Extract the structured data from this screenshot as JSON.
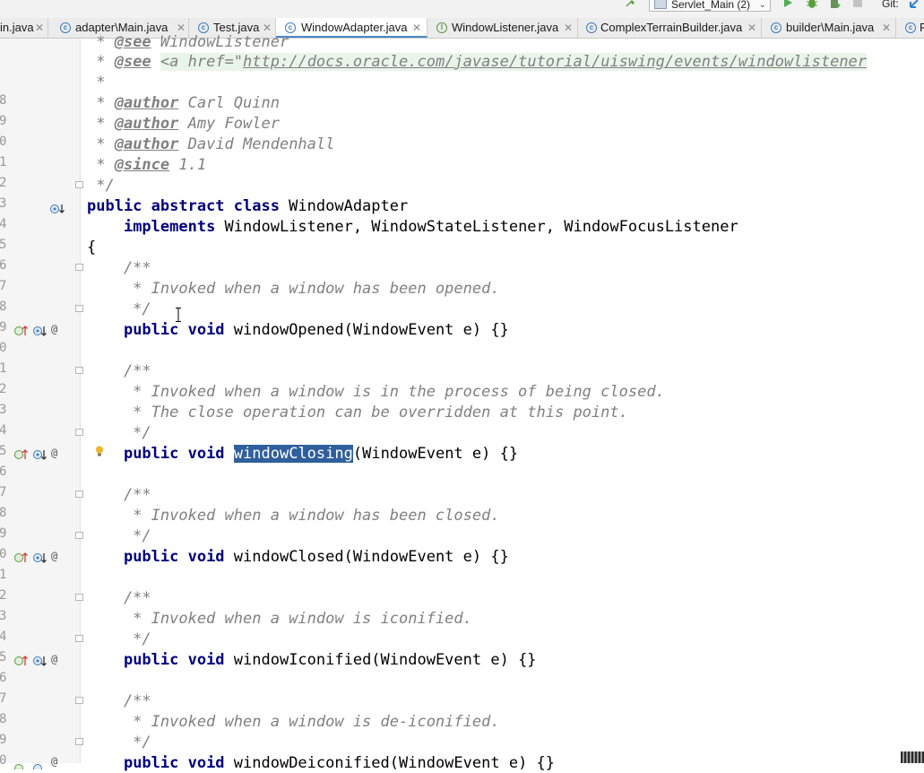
{
  "toolbar": {
    "run_config": "Servlet_Main (2)",
    "git_label": "Git:",
    "icons": [
      "hammer-icon",
      "run-icon",
      "debug-icon",
      "coverage-icon",
      "stop-icon",
      "vcs-update-icon"
    ]
  },
  "tabs": [
    {
      "label": "in.java",
      "icon": "class-icon",
      "active": false
    },
    {
      "label": "adapter\\Main.java",
      "icon": "class-icon",
      "active": false
    },
    {
      "label": "Test.java",
      "icon": "class-icon",
      "active": false
    },
    {
      "label": "WindowAdapter.java",
      "icon": "class-icon",
      "active": true
    },
    {
      "label": "WindowListener.java",
      "icon": "interface-icon",
      "active": false
    },
    {
      "label": "ComplexTerrainBuilder.java",
      "icon": "class-icon",
      "active": false
    },
    {
      "label": "builder\\Main.java",
      "icon": "class-icon",
      "active": false
    },
    {
      "label": "P",
      "icon": "class-icon",
      "active": false
    }
  ],
  "editor": {
    "line_numbers": [
      "",
      "8",
      "9",
      "0",
      "1",
      "2",
      "3",
      "4",
      "5",
      "6",
      "7",
      "8",
      "9",
      "0",
      "1",
      "2",
      "3",
      "4",
      "5",
      "6",
      "7",
      "8",
      "9",
      "0",
      "1",
      "2",
      "3",
      "4",
      "5",
      "6",
      "7",
      "8",
      "9",
      "0",
      "1",
      "2"
    ],
    "lines": {
      "l0": {
        "prefix": " * ",
        "tag": "@see",
        "rest": " WindowListener"
      },
      "l1": {
        "prefix": " * ",
        "tag": "@see",
        "sp": " ",
        "link": "<a href=\"",
        "url": "http://docs.oracle.com/javase/tutorial/uiswing/events/windowlistener"
      },
      "l2": " *",
      "l3": {
        "prefix": " * ",
        "tag": "@author",
        "rest": " Carl Quinn"
      },
      "l4": {
        "prefix": " * ",
        "tag": "@author",
        "rest": " Amy Fowler"
      },
      "l5": {
        "prefix": " * ",
        "tag": "@author",
        "rest": " David Mendenhall"
      },
      "l6": {
        "prefix": " * ",
        "tag": "@since",
        "rest": " 1.1"
      },
      "l7": " */",
      "l8": {
        "kw": "public abstract class",
        "rest": " WindowAdapter"
      },
      "l9": {
        "indent": "    ",
        "kw": "implements",
        "rest": " WindowListener, WindowStateListener, WindowFocusListener"
      },
      "l10": "{",
      "l11": "    /**",
      "l12": "     * Invoked when a window has been opened.",
      "l13": "     */",
      "l14": {
        "indent": "    ",
        "kw": "public void",
        "rest": " windowOpened(WindowEvent e) {}"
      },
      "l16": "    /**",
      "l17": "     * Invoked when a window is in the process of being closed.",
      "l18": "     * The close operation can be overridden at this point.",
      "l19": "     */",
      "l20": {
        "indent": "    ",
        "kw": "public void",
        "sp": " ",
        "sel": "windowClosing",
        "rest": "(WindowEvent e) {}"
      },
      "l22": "    /**",
      "l23": "     * Invoked when a window has been closed.",
      "l24": "     */",
      "l25": {
        "indent": "    ",
        "kw": "public void",
        "rest": " windowClosed(WindowEvent e) {}"
      },
      "l27": "    /**",
      "l28": "     * Invoked when a window is iconified.",
      "l29": "     */",
      "l30": {
        "indent": "    ",
        "kw": "public void",
        "rest": " windowIconified(WindowEvent e) {}"
      },
      "l32": "    /**",
      "l33": "     * Invoked when a window is de-iconified.",
      "l34": "     */",
      "l35": {
        "indent": "    ",
        "kw": "public void",
        "rest": " windowDeiconified(WindowEvent e) {}"
      }
    },
    "override_marker": "@"
  },
  "colors": {
    "keyword": "#000080",
    "comment": "#808080",
    "selection": "#2f5f9c",
    "tab_active_border": "#4a88c7"
  }
}
